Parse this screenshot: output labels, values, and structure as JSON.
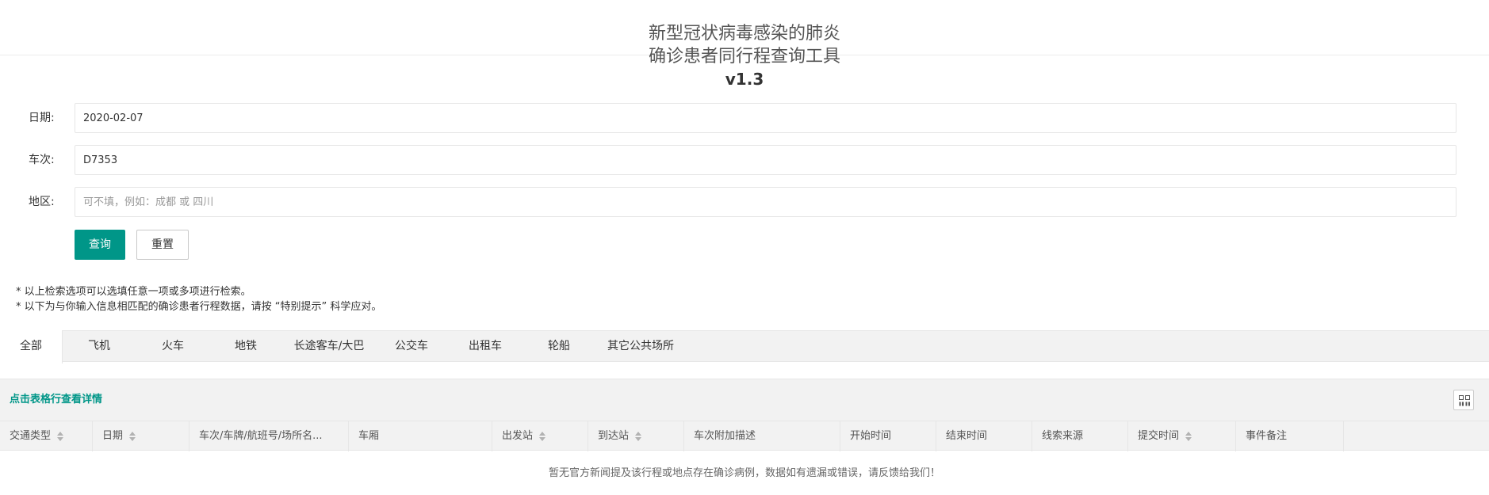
{
  "header": {
    "title_line1": "新型冠状病毒感染的肺炎",
    "title_line2": "确诊患者同行程查询工具",
    "version": "v1.3"
  },
  "form": {
    "date": {
      "label": "日期:",
      "value": "2020-02-07",
      "placeholder": ""
    },
    "train": {
      "label": "车次:",
      "value": "D7353",
      "placeholder": ""
    },
    "region": {
      "label": "地区:",
      "value": "",
      "placeholder": "可不填，例如：成都 或 四川"
    },
    "query_label": "查询",
    "reset_label": "重置"
  },
  "notes": [
    "* 以上检索选项可以选填任意一项或多项进行检索。",
    "* 以下为与你输入信息相匹配的确诊患者行程数据，请按 “特别提示” 科学应对。"
  ],
  "tabs": [
    "全部",
    "飞机",
    "火车",
    "地铁",
    "长途客车/大巴",
    "公交车",
    "出租车",
    "轮船",
    "其它公共场所"
  ],
  "active_tab": "全部",
  "table": {
    "toolbar_hint": "点击表格行查看详情",
    "columns_icon": "columns-icon",
    "columns": [
      "交通类型",
      "日期",
      "车次/车牌/航班号/场所名...",
      "车厢",
      "出发站",
      "到达站",
      "车次附加描述",
      "开始时间",
      "结束时间",
      "线索来源",
      "提交时间",
      "事件备注"
    ],
    "sortable": [
      true,
      true,
      false,
      false,
      true,
      true,
      false,
      false,
      false,
      false,
      true,
      false
    ],
    "empty_text": "暂无官方新闻提及该行程或地点存在确诊病例，数据如有遗漏或错误，请反馈给我们！"
  },
  "colors": {
    "primary": "#009688",
    "header_bg": "#f2f2f2",
    "border": "#e6e6e6"
  }
}
